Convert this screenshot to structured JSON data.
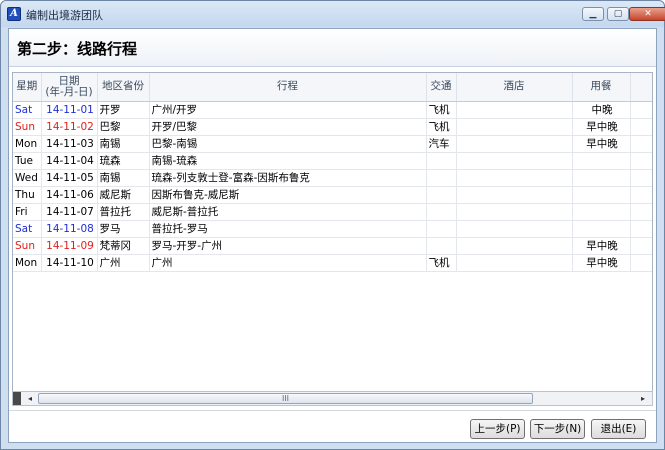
{
  "window": {
    "title": "编制出境游团队",
    "icon_letter": "A"
  },
  "page": {
    "title": "第二步：线路行程"
  },
  "columns": {
    "weekday": "星期",
    "date_line1": "日期",
    "date_line2": "(年-月-日)",
    "region": "地区省份",
    "route": "行程",
    "transport": "交通",
    "hotel": "酒店",
    "meals": "用餐"
  },
  "rows": [
    {
      "weekday": "Sat",
      "date": "14-11-01",
      "region": "开罗",
      "route": "广州/开罗",
      "transport": "飞机",
      "hotel": "",
      "meals": "中晚",
      "color": "blue"
    },
    {
      "weekday": "Sun",
      "date": "14-11-02",
      "region": "巴黎",
      "route": "开罗/巴黎",
      "transport": "飞机",
      "hotel": "",
      "meals": "早中晚",
      "color": "red"
    },
    {
      "weekday": "Mon",
      "date": "14-11-03",
      "region": "南锡",
      "route": "巴黎-南锡",
      "transport": "汽车",
      "hotel": "",
      "meals": "早中晚",
      "color": ""
    },
    {
      "weekday": "Tue",
      "date": "14-11-04",
      "region": "琉森",
      "route": "南锡-琉森",
      "transport": "",
      "hotel": "",
      "meals": "",
      "color": ""
    },
    {
      "weekday": "Wed",
      "date": "14-11-05",
      "region": "南锡",
      "route": "琉森-列支敦士登-富森-因斯布鲁克",
      "transport": "",
      "hotel": "",
      "meals": "",
      "color": ""
    },
    {
      "weekday": "Thu",
      "date": "14-11-06",
      "region": "威尼斯",
      "route": "因斯布鲁克-威尼斯",
      "transport": "",
      "hotel": "",
      "meals": "",
      "color": ""
    },
    {
      "weekday": "Fri",
      "date": "14-11-07",
      "region": "普拉托",
      "route": "威尼斯-普拉托",
      "transport": "",
      "hotel": "",
      "meals": "",
      "color": ""
    },
    {
      "weekday": "Sat",
      "date": "14-11-08",
      "region": "罗马",
      "route": "普拉托-罗马",
      "transport": "",
      "hotel": "",
      "meals": "",
      "color": "blue"
    },
    {
      "weekday": "Sun",
      "date": "14-11-09",
      "region": "梵蒂冈",
      "route": "罗马-开罗-广州",
      "transport": "",
      "hotel": "",
      "meals": "早中晚",
      "color": "red"
    },
    {
      "weekday": "Mon",
      "date": "14-11-10",
      "region": "广州",
      "route": "广州",
      "transport": "飞机",
      "hotel": "",
      "meals": "早中晚",
      "color": ""
    }
  ],
  "scrollbar": {
    "thumb_grip": "III",
    "left_arrow": "◂",
    "right_arrow": "▸"
  },
  "buttons": {
    "prev": "上一步(P)",
    "next": "下一步(N)",
    "exit": "退出(E)"
  },
  "colors": {
    "saturday": "#1d2fd6",
    "sunday": "#e02020"
  }
}
